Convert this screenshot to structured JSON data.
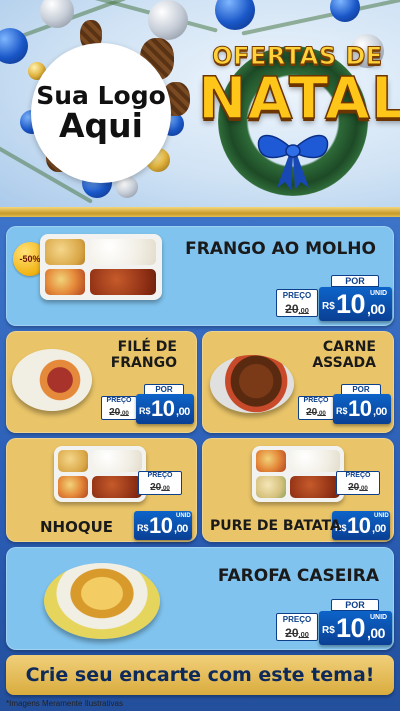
{
  "header": {
    "logo_line1": "Sua Logo",
    "logo_line2": "Aqui",
    "title_small": "OFERTAS DE",
    "title_big": "NATAL"
  },
  "badge": "-50%",
  "price_labels": {
    "por": "POR",
    "preco": "PREÇO",
    "currency": "R$",
    "unit": "UNID"
  },
  "products": [
    {
      "name": "FRANGO AO MOLHO",
      "old_price_main": "20",
      "old_price_cents": "00",
      "price_main": "10",
      "price_cents": "00"
    },
    {
      "name_line1": "FILÉ DE",
      "name_line2": "FRANGO",
      "old_price_main": "20",
      "old_price_cents": "00",
      "price_main": "10",
      "price_cents": "00"
    },
    {
      "name_line1": "CARNE",
      "name_line2": "ASSADA",
      "old_price_main": "20",
      "old_price_cents": "00",
      "price_main": "10",
      "price_cents": "00"
    },
    {
      "name": "NHOQUE",
      "old_price_main": "20",
      "old_price_cents": "00",
      "price_main": "10",
      "price_cents": "00"
    },
    {
      "name": "PURE DE BATATA",
      "old_price_main": "20",
      "old_price_cents": "00",
      "price_main": "10",
      "price_cents": "00"
    },
    {
      "name": "FAROFA CASEIRA",
      "old_price_main": "20",
      "old_price_cents": "00",
      "price_main": "10",
      "price_cents": "00"
    }
  ],
  "cta": "Crie seu encarte com este tema!",
  "disclaimer": "*Imagens Meramente Ilustrativas",
  "colors": {
    "gold_card": "#e9c468",
    "sky_card": "#7fc3ee",
    "price_blue": "#0a3f94",
    "title_gold": "#ffc61a"
  }
}
